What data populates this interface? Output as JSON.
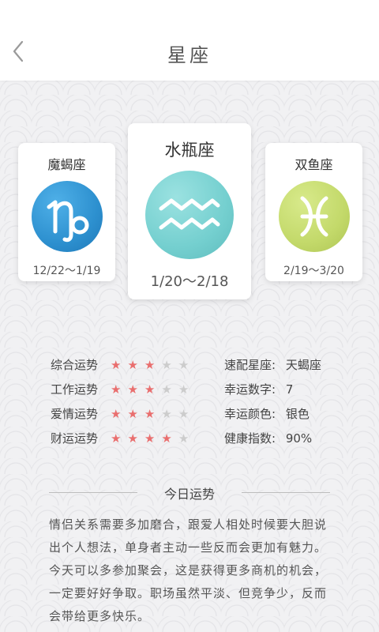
{
  "header": {
    "title": "星座",
    "back_icon": "chevron-left-icon"
  },
  "signs": {
    "left": {
      "name": "魔蝎座",
      "date": "12/22～1/19",
      "symbol": "♑",
      "color": "#2d90cf"
    },
    "center": {
      "name": "水瓶座",
      "date": "1/20～2/18",
      "symbol": "♒",
      "color": "#74cfcf"
    },
    "right": {
      "name": "双鱼座",
      "date": "2/19～3/20",
      "symbol": "♓",
      "color": "#c3d96a"
    }
  },
  "fortunes": [
    {
      "label": "综合运势",
      "stars": 3,
      "max": 5
    },
    {
      "label": "工作运势",
      "stars": 3,
      "max": 5
    },
    {
      "label": "爱情运势",
      "stars": 3,
      "max": 5
    },
    {
      "label": "财运运势",
      "stars": 4,
      "max": 5
    }
  ],
  "info": [
    {
      "label": "速配星座:",
      "value": "天蝎座"
    },
    {
      "label": "幸运数字:",
      "value": "7"
    },
    {
      "label": "幸运颜色:",
      "value": "银色"
    },
    {
      "label": "健康指数:",
      "value": "90%"
    }
  ],
  "today": {
    "title": "今日运势",
    "text": "情侣关系需要多加磨合，跟爱人相处时候要大胆说出个人想法，单身者主动一些反而会更加有魅力。今天可以多参加聚会，这是获得更多商机的机会，一定要好好争取。职场虽然平淡、但竞争少，反而会带给更多快乐。"
  },
  "colors": {
    "star_on": "#e96e6e",
    "star_off": "#cccccc"
  }
}
